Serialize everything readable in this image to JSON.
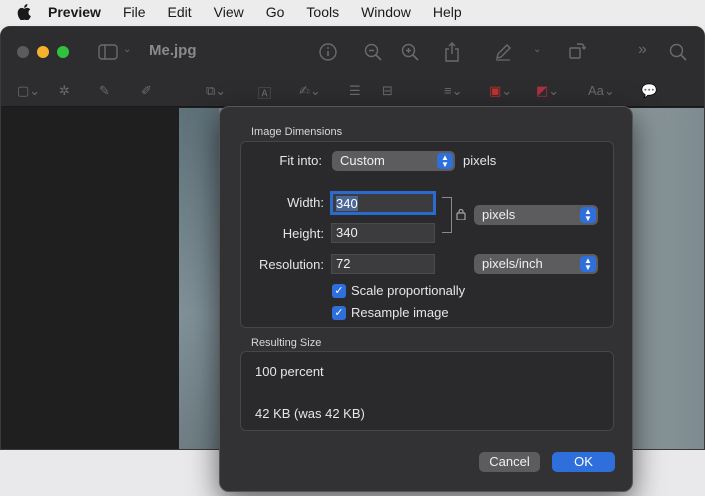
{
  "menubar": {
    "apple_icon": "apple-logo-icon",
    "items": [
      "Preview",
      "File",
      "Edit",
      "View",
      "Go",
      "Tools",
      "Window",
      "Help"
    ]
  },
  "window": {
    "title": "Me.jpg",
    "traffic_light_colors": {
      "close": "#5b5a5c",
      "minimize": "#f5b22c",
      "zoom": "#2fc23f"
    }
  },
  "dialog": {
    "image_dimensions_label": "Image Dimensions",
    "fit_into_label": "Fit into:",
    "fit_into_value": "Custom",
    "fit_into_units": "pixels",
    "width_label": "Width:",
    "width_value": "340",
    "height_label": "Height:",
    "height_value": "340",
    "size_units": "pixels",
    "resolution_label": "Resolution:",
    "resolution_value": "72",
    "resolution_units": "pixels/inch",
    "scale_proportionally": {
      "label": "Scale proportionally",
      "checked": true
    },
    "resample_image": {
      "label": "Resample image",
      "checked": true
    },
    "resulting_size_label": "Resulting Size",
    "result_percent": "100 percent",
    "result_size": "42 KB (was 42 KB)",
    "cancel_label": "Cancel",
    "ok_label": "OK",
    "accent_color": "#2e6fdb"
  }
}
